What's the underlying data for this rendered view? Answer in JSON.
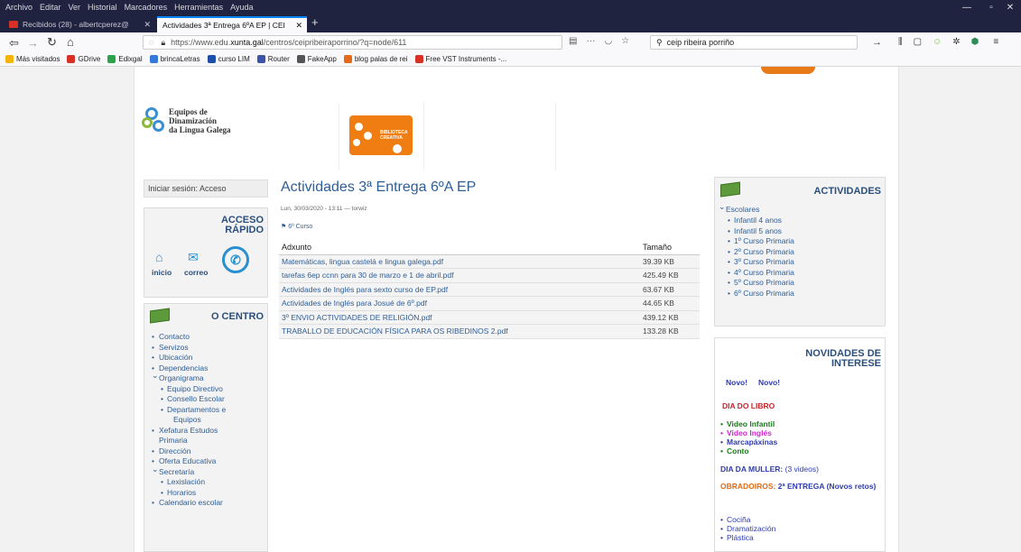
{
  "browser": {
    "menu": [
      "Archivo",
      "Editar",
      "Ver",
      "Historial",
      "Marcadores",
      "Herramientas",
      "Ayuda"
    ],
    "tabs": [
      {
        "title": "Recibidos (28) - albertcperez@",
        "active": false
      },
      {
        "title": "Actividades 3ª Entrega 6ºA EP | CEI",
        "active": true
      }
    ],
    "url": {
      "prefix": "https://www.edu.",
      "host": "xunta.gal",
      "path": "/centros/ceipribeiraporrino/?q=node/611"
    },
    "search_value": "ceip ribeira porriño",
    "bookmarks": [
      "Más visitados",
      "GDrive",
      "Edixgal",
      "brincaLetras",
      "curso LIM",
      "Router",
      "FakeApp",
      "blog palas de rei",
      "Free VST Instruments -..."
    ]
  },
  "header": {
    "edlg_logo": [
      "Equipos de",
      "Dinamización",
      "da Lingua Galega"
    ],
    "biblioteca_logo": "BIBLIOTECA CREATIVA"
  },
  "left": {
    "login": "Iniciar sesión: Acceso",
    "quick_title_1": "ACCESO",
    "quick_title_2": "RÁPIDO",
    "quick_inicio": "inicio",
    "quick_correo": "correo",
    "centro_title": "O CENTRO",
    "centro_items": [
      {
        "label": "Contacto",
        "kind": "b"
      },
      {
        "label": "Servizos",
        "kind": "b"
      },
      {
        "label": "Ubicación",
        "kind": "b"
      },
      {
        "label": "Dependencias",
        "kind": "b"
      },
      {
        "label": "Organigrama",
        "kind": "exp"
      },
      {
        "label": "Equipo Directivo",
        "kind": "sub"
      },
      {
        "label": "Consello Escolar",
        "kind": "sub"
      },
      {
        "label": "Departamentos e",
        "kind": "sub"
      },
      {
        "label": "Equipos",
        "kind": "cont"
      },
      {
        "label": "Xefatura Estudos",
        "kind": "b"
      },
      {
        "label": "Primaria",
        "kind": "cont0"
      },
      {
        "label": "Dirección",
        "kind": "b"
      },
      {
        "label": "Oferta Educativa",
        "kind": "b"
      },
      {
        "label": "Secretaría",
        "kind": "exp"
      },
      {
        "label": "Lexislación",
        "kind": "sub"
      },
      {
        "label": "Horarios",
        "kind": "sub"
      },
      {
        "label": "Calendario escolar",
        "kind": "b"
      }
    ]
  },
  "article": {
    "title": "Actividades 3ª Entrega 6ºA EP",
    "meta": "Lun, 30/03/2020 - 13:11 — torwiz",
    "tag": "6º Curso",
    "col_file": "Adxunto",
    "col_size": "Tamaño",
    "files": [
      {
        "name": "Matemáticas, lingua castelá e lingua galega.pdf",
        "size": "39.39 KB"
      },
      {
        "name": "tarefas 6ep ccnn para 30 de marzo e 1 de abril.pdf",
        "size": "425.49 KB"
      },
      {
        "name": "Actividades de Inglés para sexto curso de EP.pdf",
        "size": "63.67 KB"
      },
      {
        "name": "Actividades de Inglés para Josué de 6º.pdf",
        "size": "44.65 KB"
      },
      {
        "name": "3º ENVIO ACTIVIDADES DE RELIGIÓN.pdf",
        "size": "439.12 KB"
      },
      {
        "name": "TRABALLO DE EDUCACIÓN FÍSICA PARA OS RIBEDINOS 2.pdf",
        "size": "133.28 KB"
      }
    ]
  },
  "right": {
    "actividades_title": "ACTIVIDADES",
    "escolares": "Escolares",
    "cursos": [
      "Infantil 4 anos",
      "Infantil 5 anos",
      "1º Curso Primaria",
      "2º Curso Primaria",
      "3º Curso Primaria",
      "4º Curso Primaria",
      "5º Curso Primaria",
      "6º Curso Primaria"
    ],
    "novidades_title_1": "NOVIDADES DE",
    "novidades_title_2": "INTERESE",
    "novo_1": "Novo!",
    "novo_2": "Novo!",
    "dia_libro": "DIA DO LIBRO",
    "libro_items": [
      {
        "label": "Video Infantil",
        "color": "#1a7a1a"
      },
      {
        "label": "Video Inglés",
        "color": "#d21fd2"
      },
      {
        "label": "Marcapáxinas",
        "color": "#2e3cb0"
      },
      {
        "label": "Conto",
        "color": "#1a7a1a"
      }
    ],
    "dia_muller": "DIA DA MULLER:",
    "dia_muller_count": "(3 videos)",
    "obradoiros": "OBRADOIROS:",
    "obradoiros_2": "2ª ENTREGA (Novos retos)",
    "obradoiros_items": [
      "Cociña",
      "Dramatización",
      "Plástica"
    ]
  }
}
